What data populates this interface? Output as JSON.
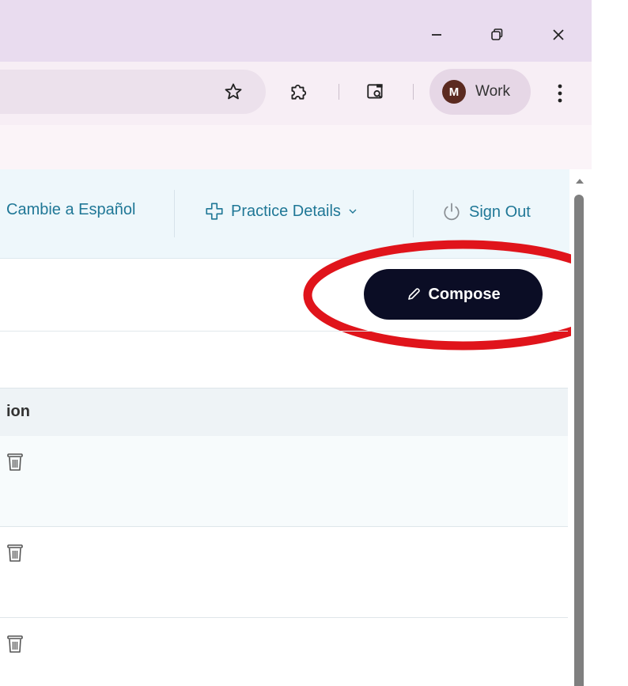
{
  "browser": {
    "window_controls": {
      "minimize_icon": "minimize-icon",
      "restore_icon": "restore-icon",
      "close_icon": "close-icon"
    },
    "toolbar": {
      "bookmark_icon": "star-icon",
      "extensions_icon": "puzzle-icon",
      "lens_icon": "search-page-icon",
      "profile": {
        "initial": "M",
        "label": "Work",
        "avatar_color": "#5b2a20"
      },
      "menu_icon": "kebab-icon"
    }
  },
  "header": {
    "language_link": "Cambie a Español",
    "practice_details": "Practice Details",
    "sign_out": "Sign Out",
    "link_color": "#1f7796"
  },
  "main": {
    "compose_label": "Compose",
    "compose_color": "#0b0d25",
    "annotation_color": "#e0141b"
  },
  "table": {
    "column_header": "ion",
    "rows": [
      {
        "action_icon": "trash-icon"
      },
      {
        "action_icon": "trash-icon"
      },
      {
        "action_icon": "trash-icon"
      }
    ]
  }
}
